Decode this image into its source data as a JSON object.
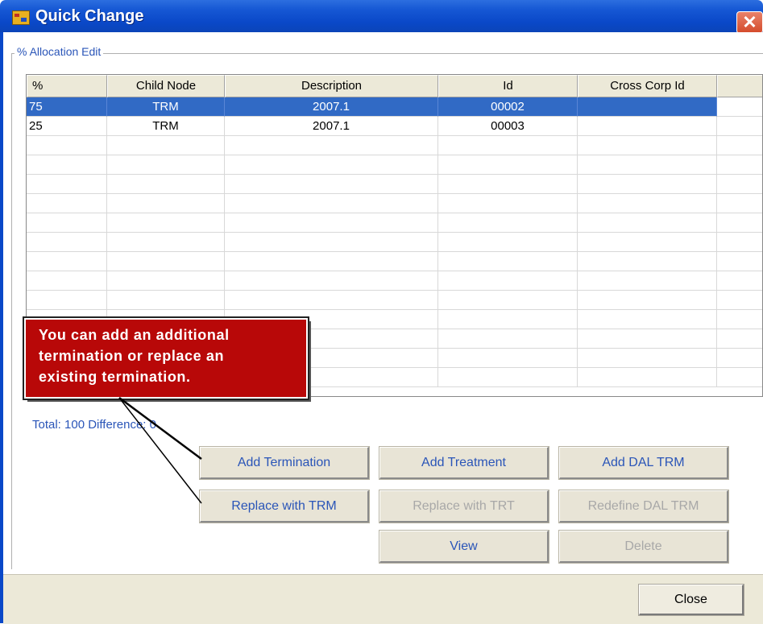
{
  "window": {
    "title": "Quick Change",
    "close_glyph": "✕"
  },
  "groupbox": {
    "label": "% Allocation Edit"
  },
  "grid": {
    "columns": [
      "%",
      "Child Node",
      "Description",
      "Id",
      "Cross Corp Id"
    ],
    "rows": [
      {
        "pct": "75",
        "child_node": "TRM",
        "description": "2007.1",
        "id": "00002",
        "cross_corp_id": "",
        "selected": true
      },
      {
        "pct": "25",
        "child_node": "TRM",
        "description": "2007.1",
        "id": "00003",
        "cross_corp_id": "",
        "selected": false
      }
    ]
  },
  "total": {
    "text": "Total: 100 Difference: 0"
  },
  "buttons": {
    "add_termination": "Add Termination",
    "add_treatment": "Add Treatment",
    "add_dal_trm": "Add DAL TRM",
    "replace_with_trm": "Replace with TRM",
    "replace_with_trt": "Replace with TRT",
    "redefine_dal_trm": "Redefine DAL TRM",
    "view": "View",
    "delete": "Delete",
    "close": "Close"
  },
  "callout": {
    "lines": [
      "You can add an additional",
      "termination or replace an",
      "existing termination."
    ]
  },
  "colors": {
    "titlebar": "#0a48c8",
    "selection": "#316ac5",
    "callout_bg": "#b80808",
    "link_text": "#2a55b8"
  }
}
